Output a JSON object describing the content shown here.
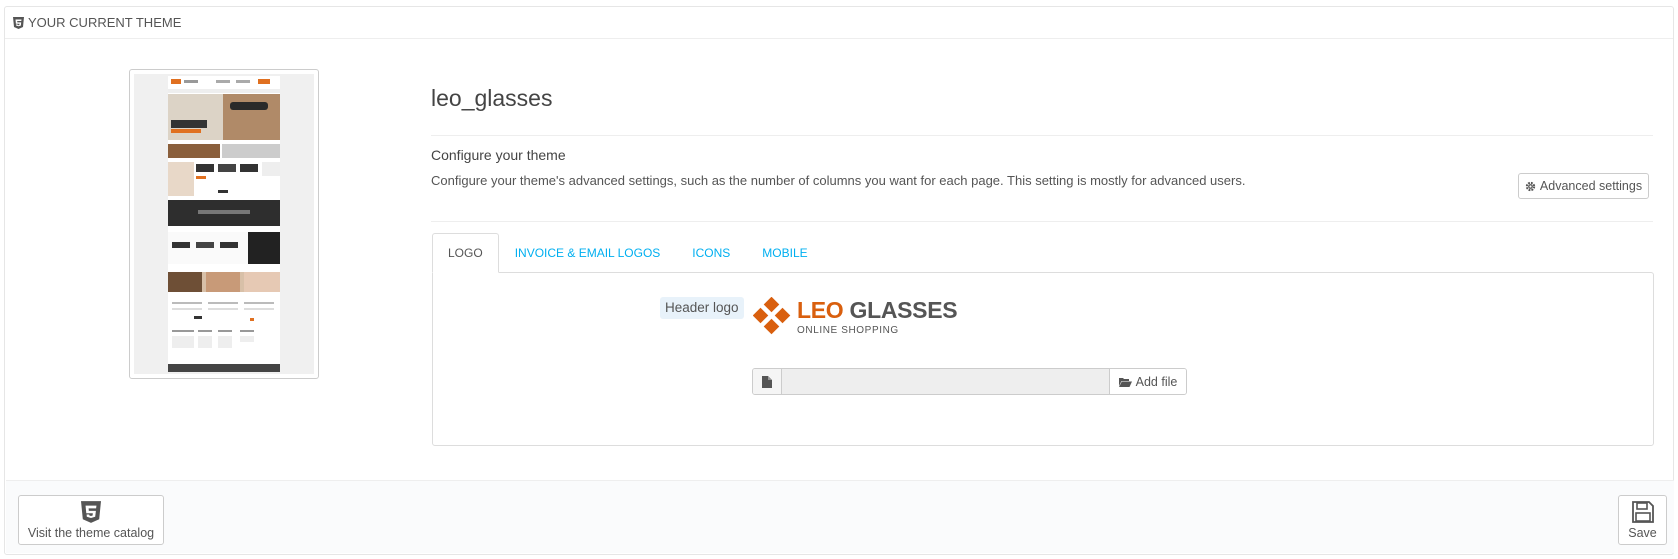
{
  "panel": {
    "heading": "YOUR CURRENT THEME",
    "heading_icon": "html5-icon"
  },
  "theme": {
    "name": "leo_glasses",
    "preview_alt": "Theme preview thumbnail"
  },
  "configure": {
    "title": "Configure your theme",
    "description": "Configure your theme's advanced settings, such as the number of columns you want for each page. This setting is mostly for advanced users.",
    "advanced_button": "Advanced settings",
    "advanced_icon": "gear-icon"
  },
  "tabs": [
    {
      "label": "LOGO",
      "active": true
    },
    {
      "label": "INVOICE & EMAIL LOGOS",
      "active": false
    },
    {
      "label": "ICONS",
      "active": false
    },
    {
      "label": "MOBILE",
      "active": false
    }
  ],
  "logo_field": {
    "label": "Header logo",
    "logo_word1": "LEO",
    "logo_word2": "GLASSES",
    "logo_sub": "ONLINE SHOPPING",
    "file_value": "",
    "add_file_label": "Add file"
  },
  "footer": {
    "catalog_button": "Visit the theme catalog",
    "save_button": "Save"
  },
  "colors": {
    "accent": "#00aff0",
    "logo_orange": "#d95f0e",
    "label_bg": "#e8f2fa"
  }
}
